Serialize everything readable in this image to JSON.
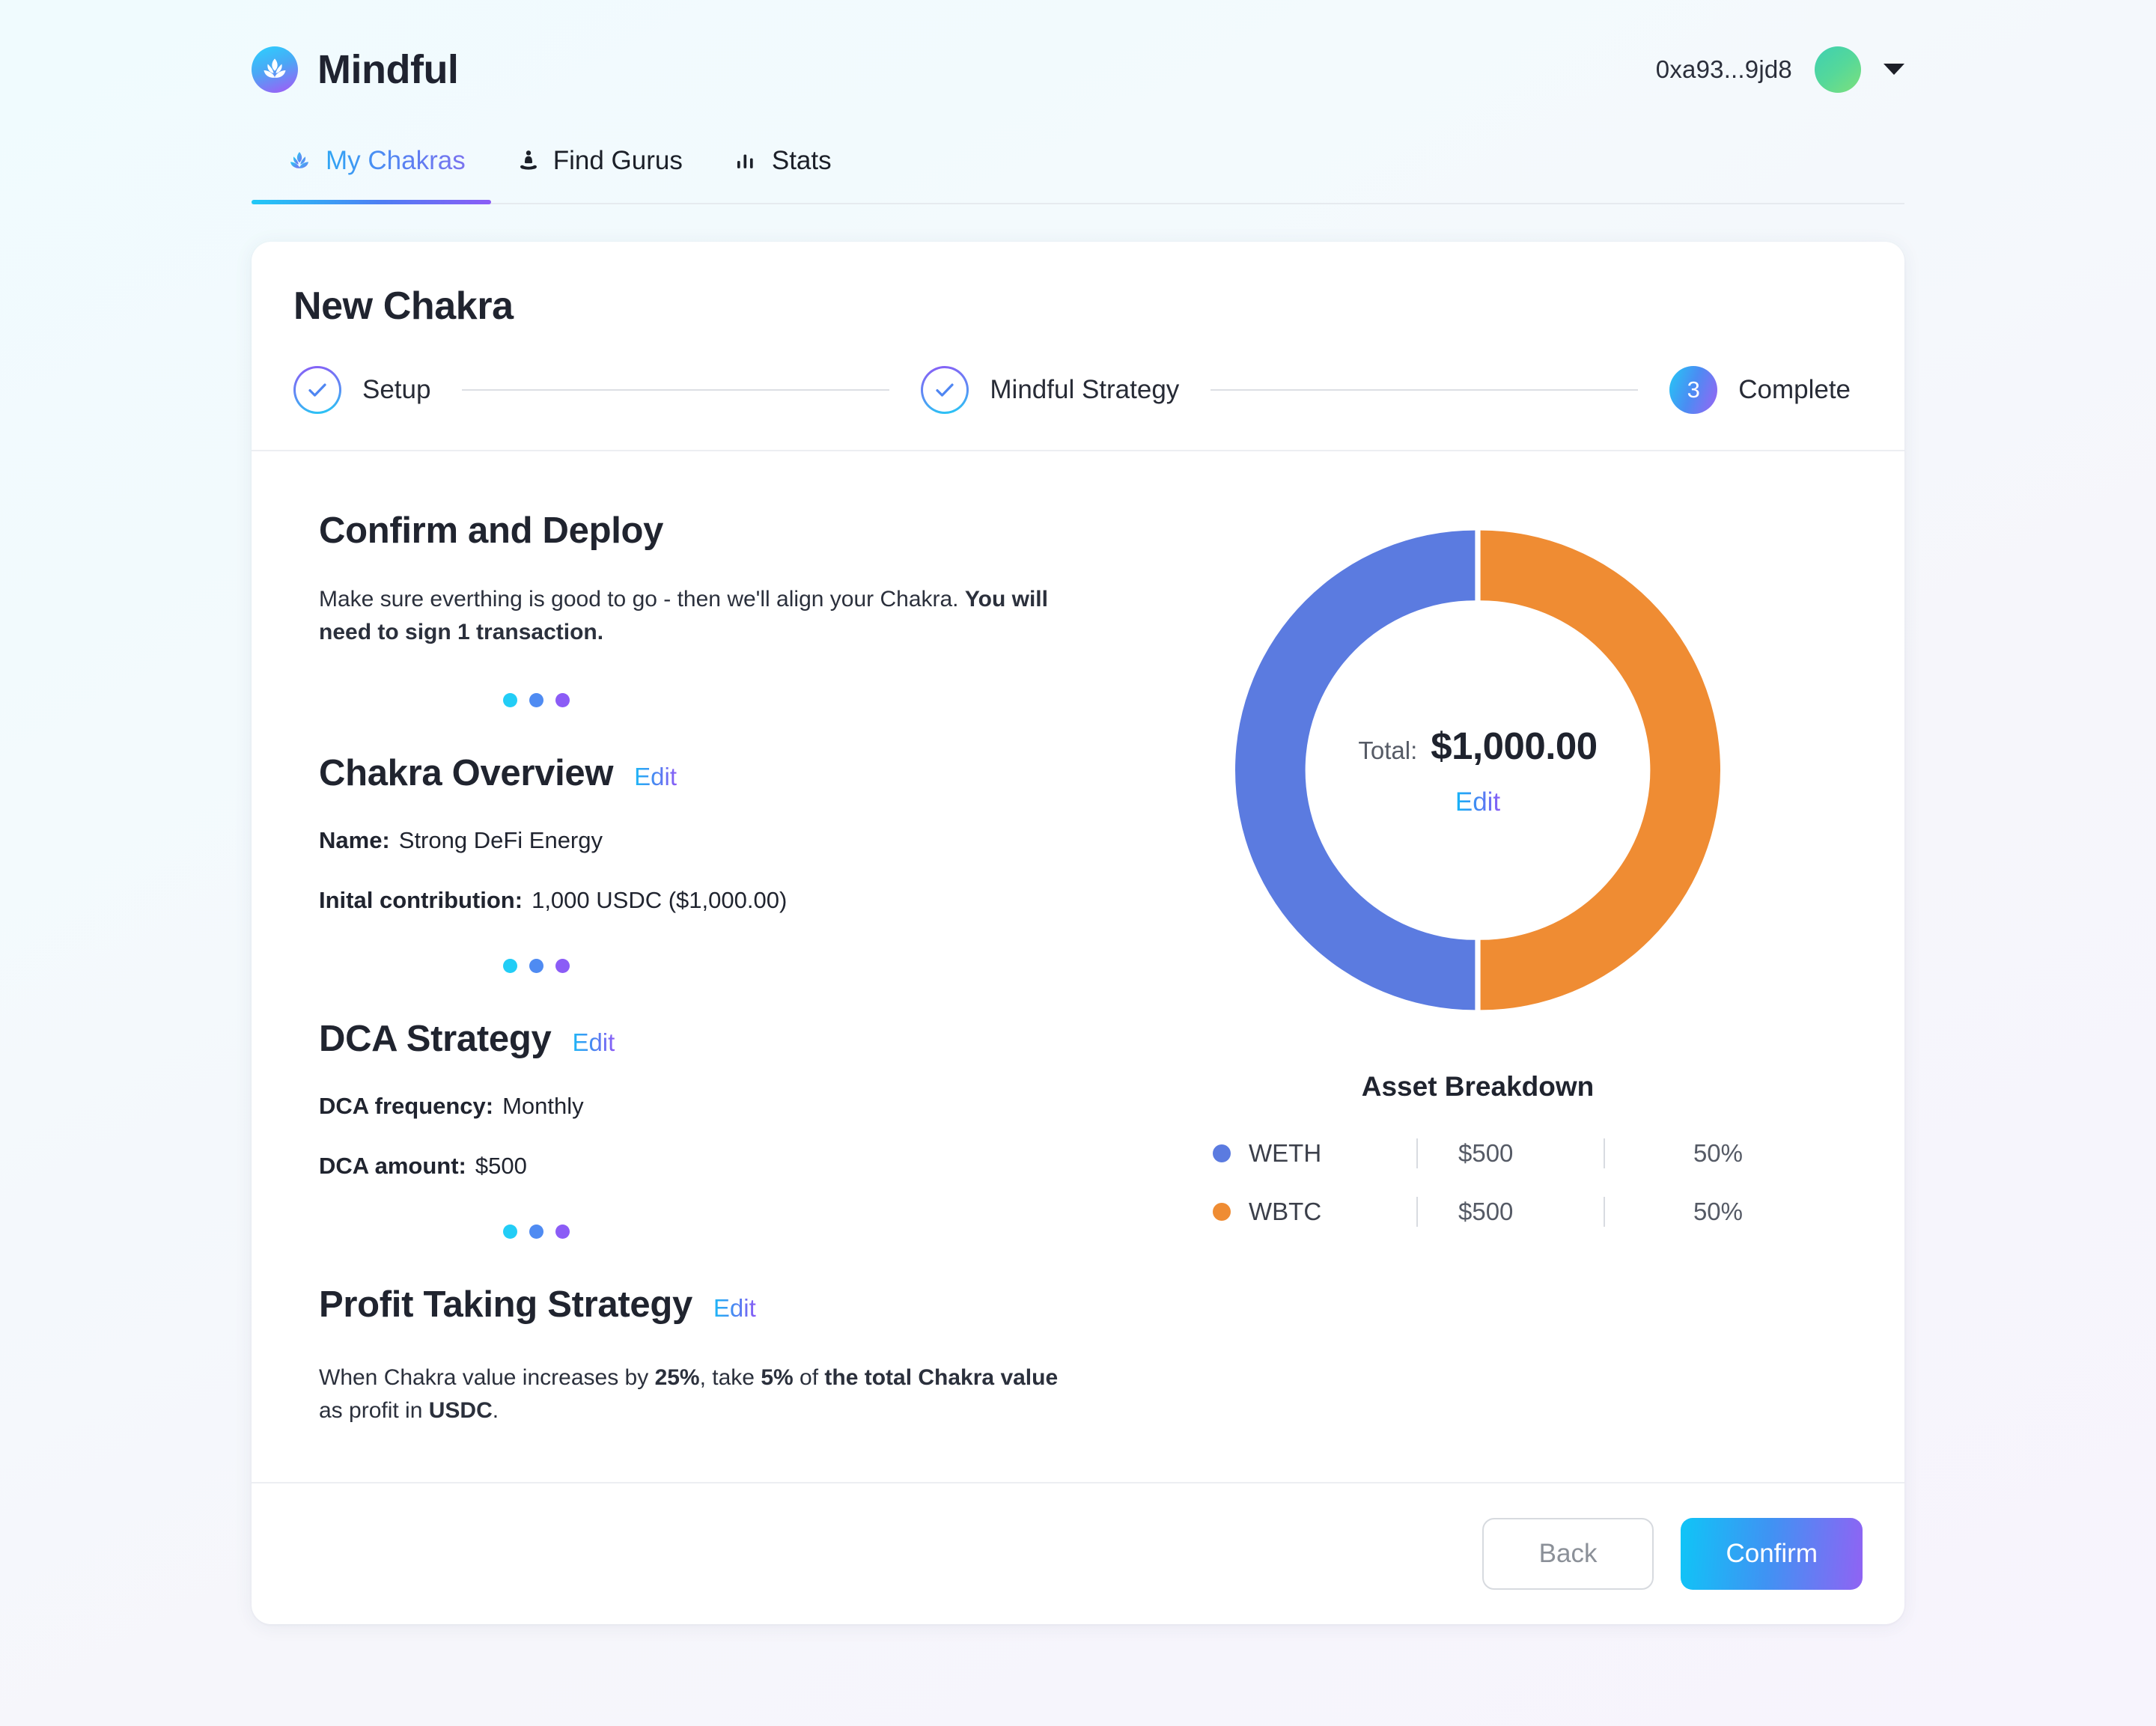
{
  "header": {
    "brand": "Mindful",
    "brand_icon": "lotus-icon",
    "account_address": "0xa93...9jd8",
    "avatar_icon": "avatar-gradient",
    "chevron_icon": "chevron-down-icon"
  },
  "tabs": [
    {
      "label": "My Chakras",
      "icon": "lotus-icon",
      "active": true
    },
    {
      "label": "Find Gurus",
      "icon": "meditating-person-icon",
      "active": false
    },
    {
      "label": "Stats",
      "icon": "bar-chart-icon",
      "active": false
    }
  ],
  "wizard": {
    "title": "New Chakra",
    "steps": [
      {
        "label": "Setup",
        "marker": "check",
        "state": "done"
      },
      {
        "label": "Mindful Strategy",
        "marker": "check",
        "state": "done"
      },
      {
        "label": "Complete",
        "marker": "3",
        "state": "current"
      }
    ]
  },
  "main": {
    "heading": "Confirm and Deploy",
    "lead_plain": "Make sure everthing is good to go - then we'll align your Chakra. ",
    "lead_bold": "You will need to sign 1 transaction.",
    "overview": {
      "title": "Chakra Overview",
      "edit_label": "Edit",
      "rows": [
        {
          "key": "Name:",
          "value": "Strong DeFi Energy"
        },
        {
          "key": "Inital contribution:",
          "value": "1,000 USDC ($1,000.00)"
        }
      ]
    },
    "dca": {
      "title": "DCA Strategy",
      "edit_label": "Edit",
      "rows": [
        {
          "key": "DCA frequency:",
          "value": "Monthly"
        },
        {
          "key": "DCA amount:",
          "value": "$500"
        }
      ]
    },
    "profit": {
      "title": "Profit Taking Strategy",
      "edit_label": "Edit",
      "text_1": "When Chakra value increases by ",
      "bold_1": "25%",
      "text_2": ", take ",
      "bold_2": "5%",
      "text_3": " of ",
      "bold_3": "the total Chakra value",
      "text_4": " as profit in ",
      "bold_4": "USDC",
      "text_5": "."
    }
  },
  "chart_panel": {
    "total_label": "Total:",
    "total_value": "$1,000.00",
    "edit_label": "Edit",
    "breakdown_title": "Asset Breakdown"
  },
  "footer": {
    "back_label": "Back",
    "confirm_label": "Confirm"
  },
  "chart_data": {
    "type": "pie",
    "title": "Asset Breakdown",
    "variant": "donut",
    "center_label": "Total:",
    "center_value": "$1,000.00",
    "total": 1000,
    "currency": "USD",
    "legend_position": "bottom",
    "categories": [
      "WETH",
      "WBTC"
    ],
    "values": [
      500,
      500
    ],
    "percents": [
      50,
      50
    ],
    "value_labels": [
      "$500",
      "$500"
    ],
    "percent_labels": [
      "50%",
      "50%"
    ],
    "colors": [
      "#5b7be0",
      "#ef8c33"
    ],
    "slices": [
      {
        "name": "WETH",
        "value": 500,
        "value_label": "$500",
        "percent": 50,
        "percent_label": "50%",
        "color": "#5b7be0"
      },
      {
        "name": "WBTC",
        "value": 500,
        "value_label": "$500",
        "percent": 50,
        "percent_label": "50%",
        "color": "#ef8c33"
      }
    ]
  },
  "theme": {
    "accent_cyan": "#1cb8f7",
    "accent_blue": "#4f82f1",
    "accent_purple": "#8b5cf6",
    "weth_color": "#5b7be0",
    "wbtc_color": "#ef8c33"
  }
}
